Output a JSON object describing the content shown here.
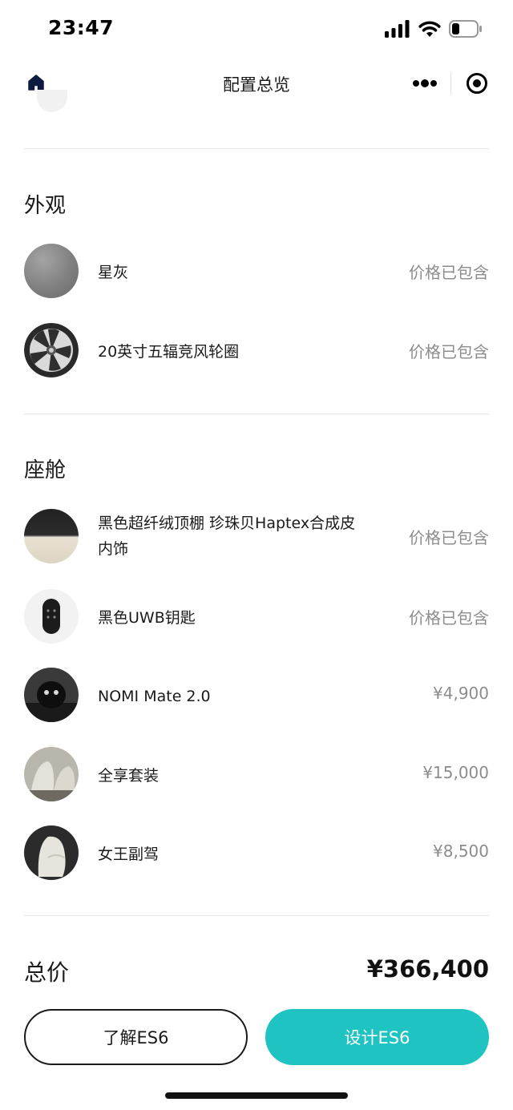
{
  "status_bar": {
    "time": "23:47"
  },
  "nav": {
    "title": "配置总览"
  },
  "sections": {
    "exterior": {
      "title": "外观",
      "items": [
        {
          "name": "星灰",
          "price": "价格已包含"
        },
        {
          "name": "20英寸五辐竞风轮圈",
          "price": "价格已包含"
        }
      ]
    },
    "cabin": {
      "title": "座舱",
      "items": [
        {
          "name": "黑色超纤绒顶棚 珍珠贝Haptex合成皮内饰",
          "price": "价格已包含"
        },
        {
          "name": "黑色UWB钥匙",
          "price": "价格已包含"
        },
        {
          "name": "NOMI Mate 2.0",
          "price": "¥4,900"
        },
        {
          "name": "全享套装",
          "price": "¥15,000"
        },
        {
          "name": "女王副驾",
          "price": "¥8,500"
        }
      ]
    }
  },
  "total": {
    "label": "总价",
    "value": "¥366,400"
  },
  "buttons": {
    "learn": "了解ES6",
    "design": "设计ES6"
  },
  "colors": {
    "accent": "#1fc3c1",
    "price_muted": "#8c8c8c",
    "text": "#1a1a1a"
  },
  "icons": {
    "home": "home-icon",
    "more": "more-dots-icon",
    "close": "miniprogram-close-icon",
    "signal": "cellular-signal-icon",
    "wifi": "wifi-icon",
    "battery": "battery-icon"
  }
}
